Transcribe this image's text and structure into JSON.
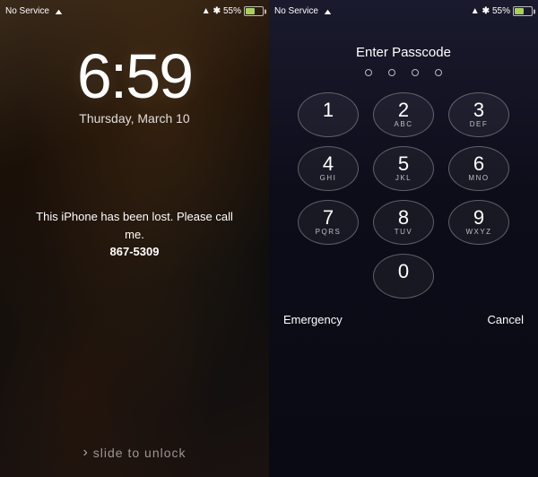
{
  "left_screen": {
    "status_bar": {
      "no_service": "No Service",
      "battery_percent": "55%"
    },
    "time": "6:59",
    "date": "Thursday, March 10",
    "lost_message_line1": "This iPhone has been lost. Please call",
    "lost_message_line2": "me.",
    "lost_message_phone": "867-5309",
    "slide_to_unlock": "slide to unlock"
  },
  "right_screen": {
    "status_bar": {
      "no_service": "No Service",
      "battery_percent": "55%"
    },
    "title": "Enter Passcode",
    "keys": [
      {
        "number": "1",
        "letters": ""
      },
      {
        "number": "2",
        "letters": "ABC"
      },
      {
        "number": "3",
        "letters": "DEF"
      },
      {
        "number": "4",
        "letters": "GHI"
      },
      {
        "number": "5",
        "letters": "JKL"
      },
      {
        "number": "6",
        "letters": "MNO"
      },
      {
        "number": "7",
        "letters": "PQRS"
      },
      {
        "number": "8",
        "letters": "TUV"
      },
      {
        "number": "9",
        "letters": "WXYZ"
      },
      {
        "number": "0",
        "letters": ""
      }
    ],
    "emergency_btn": "Emergency",
    "cancel_btn": "Cancel"
  },
  "colors": {
    "accent": "#a8d060",
    "key_border": "rgba(255,255,255,0.3)"
  }
}
